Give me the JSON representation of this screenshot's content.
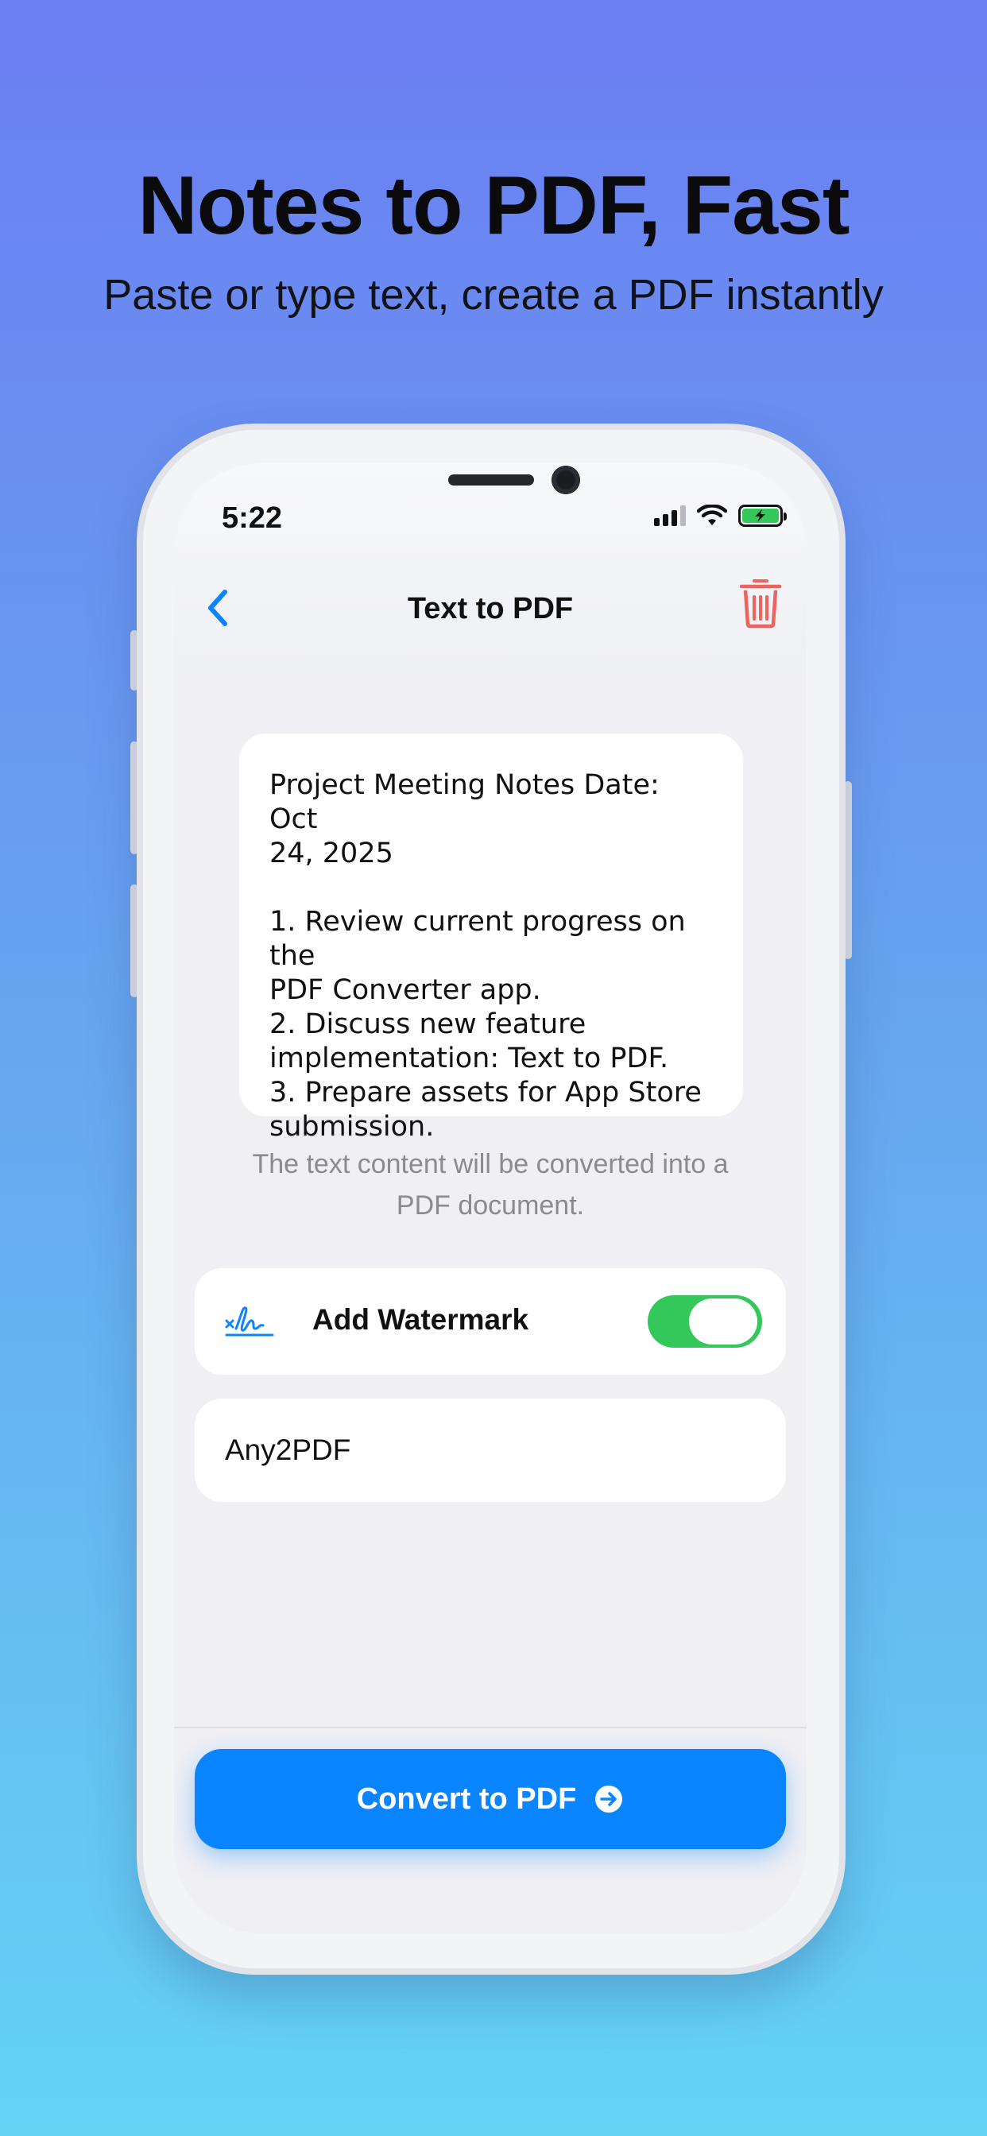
{
  "marketing": {
    "headline": "Notes to PDF, Fast",
    "subheadline": "Paste or type text, create a PDF instantly"
  },
  "status_bar": {
    "time": "5:22",
    "icons": [
      "cellular-signal-icon",
      "wifi-icon",
      "battery-charging-icon"
    ],
    "battery_color": "#34c759"
  },
  "nav": {
    "title": "Text to PDF",
    "back_icon": "chevron-left-icon",
    "delete_icon": "trash-icon",
    "back_color": "#0a84ff",
    "delete_color": "#f0625d"
  },
  "editor": {
    "content": "Project Meeting Notes Date: Oct\n24, 2025\n\n1. Review current progress on the\nPDF Converter app.\n2. Discuss new feature\nimplementation: Text to PDF.\n3. Prepare assets for App Store\nsubmission."
  },
  "hint": "The text content will be converted into a PDF document.",
  "watermark": {
    "label": "Add Watermark",
    "icon": "signature-icon",
    "enabled": true,
    "toggle_color": "#34c759",
    "text": "Any2PDF"
  },
  "convert": {
    "label": "Convert to PDF",
    "icon": "arrow-right-circle-icon",
    "color": "#0a84ff"
  }
}
